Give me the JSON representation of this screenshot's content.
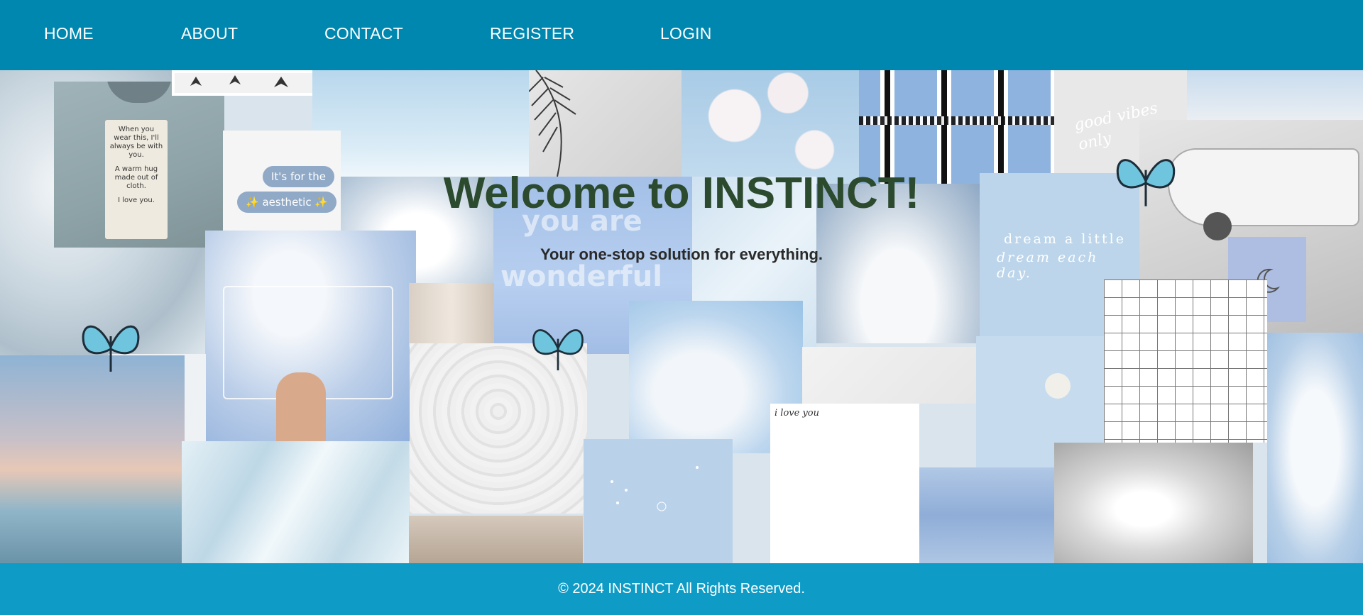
{
  "nav": {
    "home": "HOME",
    "about": "ABOUT",
    "contact": "CONTACT",
    "register": "REGISTER",
    "login": "LOGIN"
  },
  "hero": {
    "title": "Welcome to INSTINCT!",
    "subtitle": "Your one-stop solution for everything."
  },
  "collage": {
    "tag_text": [
      "When you",
      "wear this, I'll",
      "always be with",
      "you.",
      "A warm hug",
      "made out of",
      "cloth.",
      "I love you."
    ],
    "bubble_1": "It's for the",
    "bubble_2": "✨ aesthetic ✨",
    "you_are": "you are",
    "wonderful": "wonderful",
    "dream_1": "dream a little",
    "dream_2": "dream each day.",
    "good_vibes": "good vibes only",
    "i_love_you": "i love you"
  },
  "footer": {
    "copyright": "© 2024 INSTINCT All Rights Reserved."
  },
  "colors": {
    "nav_bg": "#0087b0",
    "footer_bg": "#0e9cc6",
    "hero_title": "#2b4a2e",
    "hero_subtitle": "#2a2a2a"
  }
}
